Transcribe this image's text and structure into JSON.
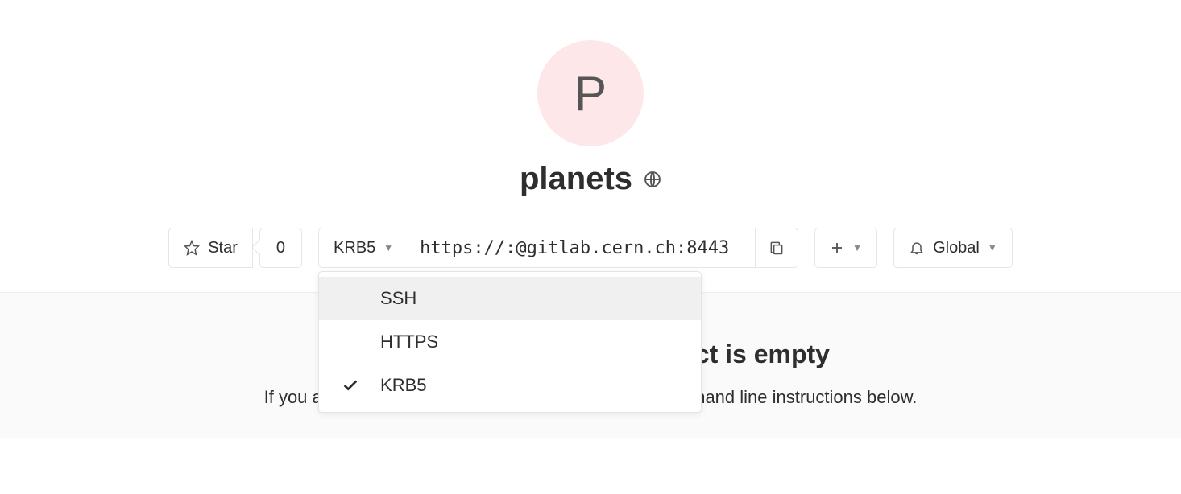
{
  "project": {
    "avatar_letter": "P",
    "name": "planets"
  },
  "toolbar": {
    "star_label": "Star",
    "star_count": "0",
    "protocol_selected": "KRB5",
    "clone_url": "https://:@gitlab.cern.ch:8443",
    "notification_label": "Global"
  },
  "protocol_dropdown": {
    "options": [
      {
        "label": "SSH",
        "selected": false
      },
      {
        "label": "HTTPS",
        "selected": false
      },
      {
        "label": "KRB5",
        "selected": true
      }
    ]
  },
  "empty_state": {
    "heading": "The repository for this project is empty",
    "subtext": "If you already have files you can push them using command line instructions below."
  }
}
